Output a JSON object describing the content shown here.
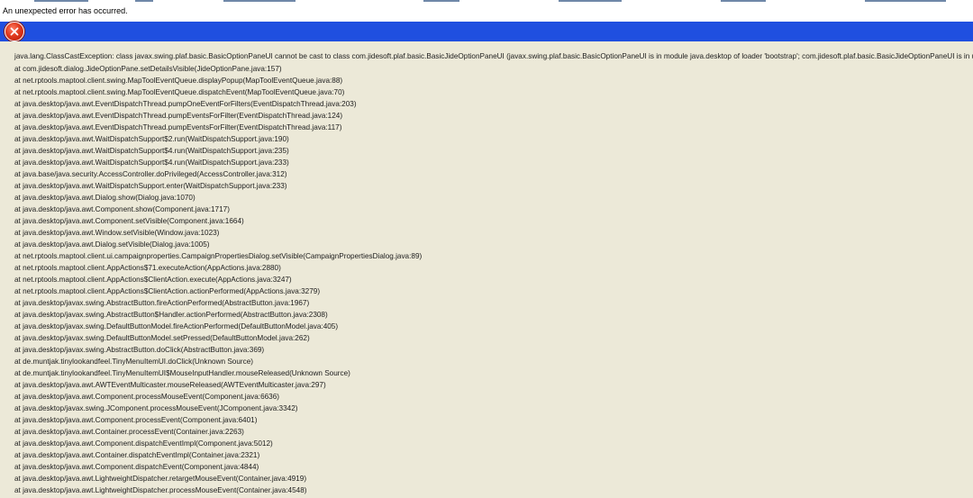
{
  "window": {
    "title": "An unexpected error has occurred."
  },
  "dialog": {
    "icon": "error-x-icon",
    "accent_color": "#1f4fe0",
    "icon_color": "#e03a1e",
    "background_color": "#ece9d8"
  },
  "stack_trace": [
    "java.lang.ClassCastException: class javax.swing.plaf.basic.BasicOptionPaneUI cannot be cast to class com.jidesoft.plaf.basic.BasicJideOptionPaneUI (javax.swing.plaf.basic.BasicOptionPaneUI is in module java.desktop of loader 'bootstrap'; com.jidesoft.plaf.basic.BasicJideOptionPaneUI is in unnamed mo",
    "at com.jidesoft.dialog.JideOptionPane.setDetailsVisible(JideOptionPane.java:157)",
    "at net.rptools.maptool.client.swing.MapToolEventQueue.displayPopup(MapToolEventQueue.java:88)",
    "at net.rptools.maptool.client.swing.MapToolEventQueue.dispatchEvent(MapToolEventQueue.java:70)",
    "at java.desktop/java.awt.EventDispatchThread.pumpOneEventForFilters(EventDispatchThread.java:203)",
    "at java.desktop/java.awt.EventDispatchThread.pumpEventsForFilter(EventDispatchThread.java:124)",
    "at java.desktop/java.awt.EventDispatchThread.pumpEventsForFilter(EventDispatchThread.java:117)",
    "at java.desktop/java.awt.WaitDispatchSupport$2.run(WaitDispatchSupport.java:190)",
    "at java.desktop/java.awt.WaitDispatchSupport$4.run(WaitDispatchSupport.java:235)",
    "at java.desktop/java.awt.WaitDispatchSupport$4.run(WaitDispatchSupport.java:233)",
    "at java.base/java.security.AccessController.doPrivileged(AccessController.java:312)",
    "at java.desktop/java.awt.WaitDispatchSupport.enter(WaitDispatchSupport.java:233)",
    "at java.desktop/java.awt.Dialog.show(Dialog.java:1070)",
    "at java.desktop/java.awt.Component.show(Component.java:1717)",
    "at java.desktop/java.awt.Component.setVisible(Component.java:1664)",
    "at java.desktop/java.awt.Window.setVisible(Window.java:1023)",
    "at java.desktop/java.awt.Dialog.setVisible(Dialog.java:1005)",
    "at net.rptools.maptool.client.ui.campaignproperties.CampaignPropertiesDialog.setVisible(CampaignPropertiesDialog.java:89)",
    "at net.rptools.maptool.client.AppActions$71.executeAction(AppActions.java:2880)",
    "at net.rptools.maptool.client.AppActions$ClientAction.execute(AppActions.java:3247)",
    "at net.rptools.maptool.client.AppActions$ClientAction.actionPerformed(AppActions.java:3279)",
    "at java.desktop/javax.swing.AbstractButton.fireActionPerformed(AbstractButton.java:1967)",
    "at java.desktop/javax.swing.AbstractButton$Handler.actionPerformed(AbstractButton.java:2308)",
    "at java.desktop/javax.swing.DefaultButtonModel.fireActionPerformed(DefaultButtonModel.java:405)",
    "at java.desktop/javax.swing.DefaultButtonModel.setPressed(DefaultButtonModel.java:262)",
    "at java.desktop/javax.swing.AbstractButton.doClick(AbstractButton.java:369)",
    "at de.muntjak.tinylookandfeel.TinyMenuItemUI.doClick(Unknown Source)",
    "at de.muntjak.tinylookandfeel.TinyMenuItemUI$MouseInputHandler.mouseReleased(Unknown Source)",
    "at java.desktop/java.awt.AWTEventMulticaster.mouseReleased(AWTEventMulticaster.java:297)",
    "at java.desktop/java.awt.Component.processMouseEvent(Component.java:6636)",
    "at java.desktop/javax.swing.JComponent.processMouseEvent(JComponent.java:3342)",
    "at java.desktop/java.awt.Component.processEvent(Component.java:6401)",
    "at java.desktop/java.awt.Container.processEvent(Container.java:2263)",
    "at java.desktop/java.awt.Component.dispatchEventImpl(Component.java:5012)",
    "at java.desktop/java.awt.Container.dispatchEventImpl(Container.java:2321)",
    "at java.desktop/java.awt.Component.dispatchEvent(Component.java:4844)",
    "at java.desktop/java.awt.LightweightDispatcher.retargetMouseEvent(Container.java:4919)",
    "at java.desktop/java.awt.LightweightDispatcher.processMouseEvent(Container.java:4548)"
  ]
}
